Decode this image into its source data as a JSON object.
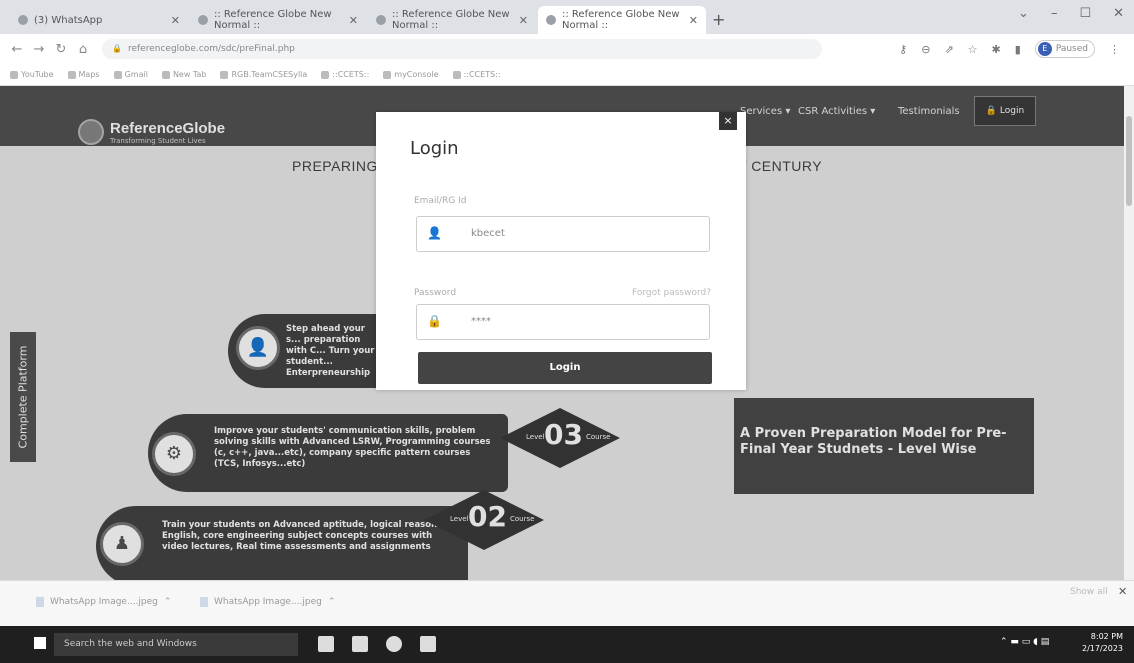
{
  "browser": {
    "tabs": [
      {
        "title": "(3) WhatsApp",
        "active": false
      },
      {
        "title": ":: Reference Globe New Normal ::",
        "active": false
      },
      {
        "title": ":: Reference Globe New Normal ::",
        "active": false
      },
      {
        "title": ":: Reference Globe New Normal ::",
        "active": true
      }
    ],
    "new_tab_label": "+",
    "url": "referenceglobe.com/sdc/preFinal.php",
    "profile_name": "Paused",
    "bookmarks": [
      "YouTube",
      "Maps",
      "Gmail",
      "New Tab",
      "RGB.TeamCSESylla",
      "::CCETS::",
      "myConsole",
      "::CCETS::"
    ]
  },
  "site": {
    "logo_name": "ReferenceGlobe",
    "logo_tagline": "Transforming Student Lives",
    "nav": [
      "Services",
      "CSR Activities",
      "Testimonials"
    ],
    "nav_login": "Login",
    "headline_left": "PREPARING",
    "headline_right": "T CENTURY",
    "side_tab": "Complete Platform",
    "step_top_text": "Step ahead your s... preparation with C... Turn your student... Enterpreneurship",
    "step_03_text": "Improve your students' communication skills, problem solving skills with Advanced LSRW, Programming courses (c, c++, java...etc), company specific pattern courses (TCS, Infosys...etc)",
    "step_02_text": "Train your students on Advanced aptitude, logical reasoning, English, core engineering subject concepts courses with video lectures, Real time assessments and assignments",
    "level_word": "Level",
    "course_word": "Course",
    "level_03": "03",
    "level_02": "02",
    "proven_text": "A Proven Preparation Model for Pre-Final Year Studnets - Level Wise"
  },
  "login_modal": {
    "title": "Login",
    "email_label": "Email/RG Id",
    "email_value": "kbecet",
    "password_label": "Password",
    "forgot_label": "Forgot password?",
    "password_value": "****",
    "submit_label": "Login",
    "close_label": "×"
  },
  "downloads": {
    "items": [
      "WhatsApp Image....jpeg",
      "WhatsApp Image....jpeg"
    ],
    "show_all": "Show all"
  },
  "taskbar": {
    "search_placeholder": "Search the web and Windows",
    "time": "8:02 PM",
    "date": "2/17/2023"
  }
}
